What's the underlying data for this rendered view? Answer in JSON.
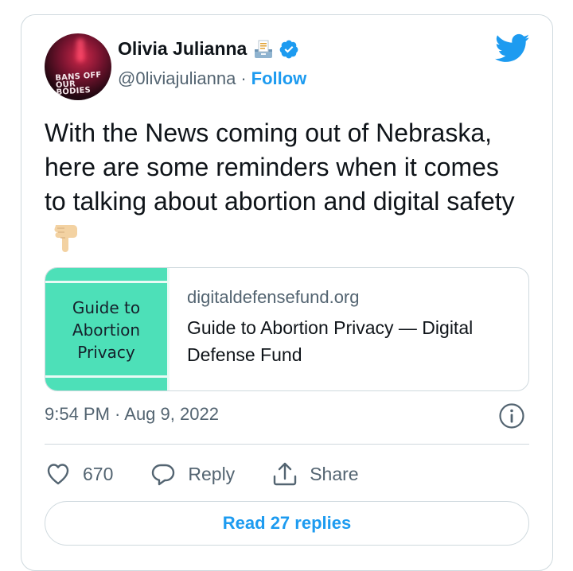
{
  "author": {
    "name": "Olivia Julianna",
    "handle": "@0liviajulianna",
    "separator": "·",
    "follow_label": "Follow",
    "avatar_text": "BANS OFF OUR BODIES",
    "verified": true
  },
  "tweet": {
    "text": "With the News coming out of Nebraska, here are some reminders when it comes to talking about abortion and digital safety"
  },
  "link_card": {
    "thumbnail_text": "Guide to Abortion Privacy",
    "domain": "digitaldefensefund.org",
    "title": "Guide to Abortion Privacy — Digital Defense Fund",
    "thumbnail_color": "#4de0b8"
  },
  "meta": {
    "timestamp": "9:54 PM · Aug 9, 2022"
  },
  "actions": {
    "likes_count": "670",
    "reply_label": "Reply",
    "share_label": "Share"
  },
  "replies_button": "Read 27 replies",
  "colors": {
    "accent": "#1d9bf0",
    "secondary_text": "#536471",
    "border": "#cfd9de"
  },
  "icons": [
    "ballot-box-icon",
    "verified-badge-icon",
    "twitter-logo-icon",
    "backhand-index-pointing-down-icon",
    "info-icon",
    "heart-icon",
    "reply-icon",
    "share-icon"
  ]
}
